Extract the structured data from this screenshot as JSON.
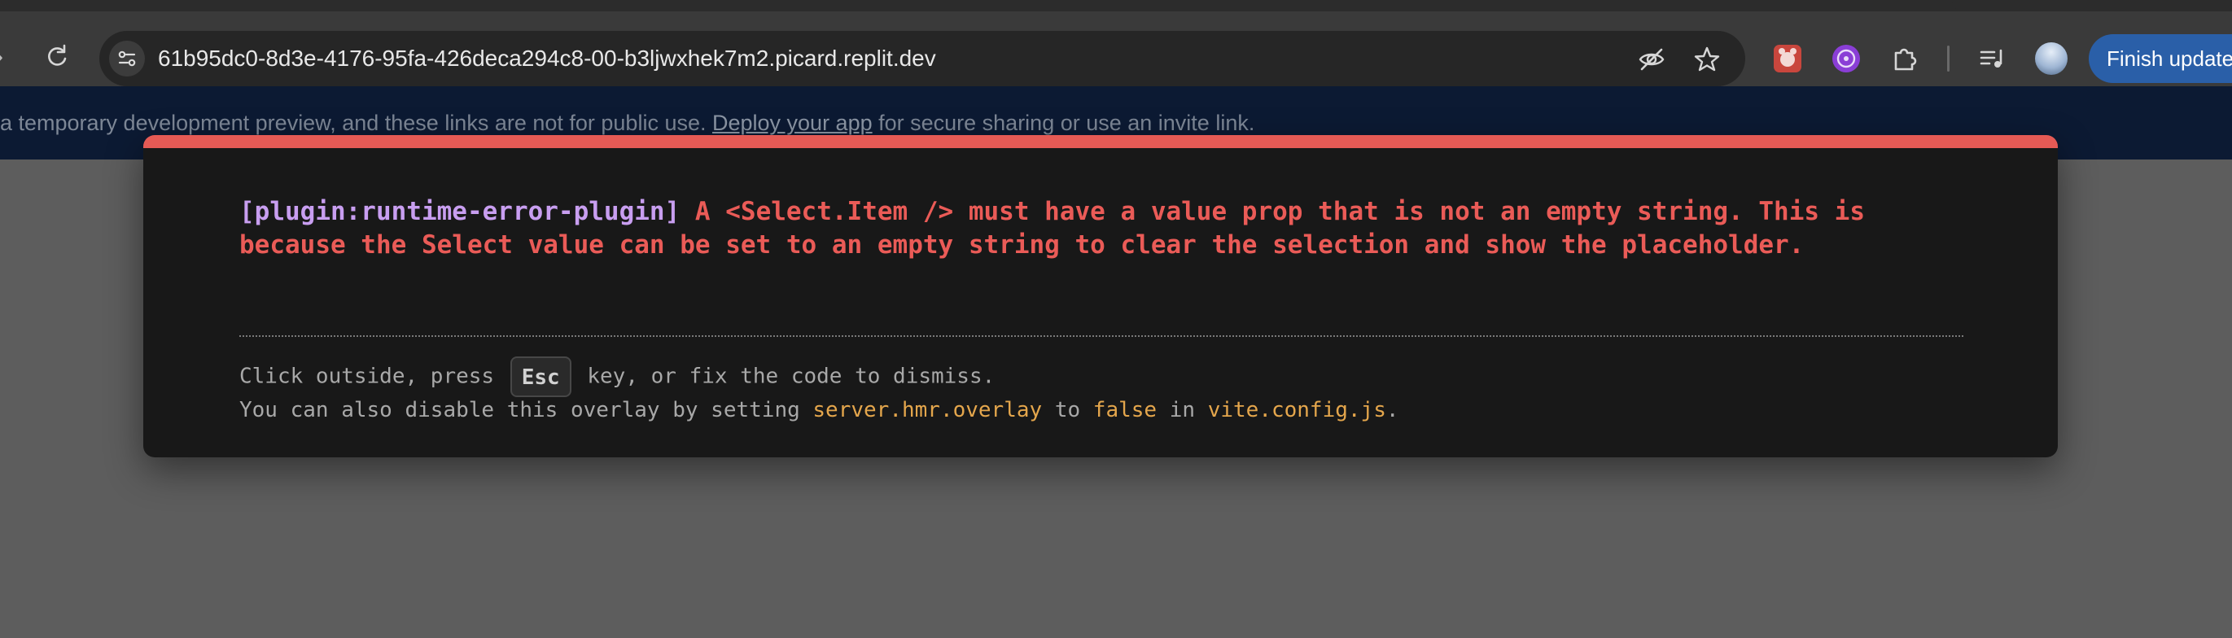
{
  "browser": {
    "url": "61b95dc0-8d3e-4176-95fa-426deca294c8-00-b3ljwxhek7m2.picard.replit.dev",
    "update_button_label": "Finish update",
    "icons": {
      "forward": "forward-arrow-icon",
      "reload": "reload-icon",
      "site_info": "site-settings-icon",
      "eye_off": "eye-off-icon",
      "star": "bookmark-star-icon",
      "ext1": "extension-app-icon",
      "ext2": "extension-purple-icon",
      "extensions": "puzzle-piece-icon",
      "media": "media-control-icon",
      "profile": "profile-avatar"
    }
  },
  "banner": {
    "text_before": "a temporary development preview, and these links are not for public use. ",
    "link": "Deploy your app",
    "text_after": " for secure sharing or use an invite link."
  },
  "overlay": {
    "plugin": "[plugin:runtime-error-plugin]",
    "message": " A <Select.Item /> must have a value prop that is not an empty string. This is\nbecause the Select value can be set to an empty string to clear the selection and show the placeholder.",
    "tip1_before": "Click outside, press",
    "kbd": "Esc",
    "tip1_after": "key, or fix the code to dismiss.",
    "tip2_a": "You can also disable this overlay by setting ",
    "tip2_code1": "server.hmr.overlay",
    "tip2_b": " to ",
    "tip2_code2": "false",
    "tip2_c": " in ",
    "tip2_code3": "vite.config.js",
    "tip2_d": "."
  },
  "colors": {
    "overlay_bg": "#181818",
    "error_red": "#ea5b57",
    "plugin_purple": "#c89ef0",
    "code_yellow": "#e4a64c",
    "banner_bg": "#0c1a33",
    "update_button": "#2a5fa8"
  }
}
